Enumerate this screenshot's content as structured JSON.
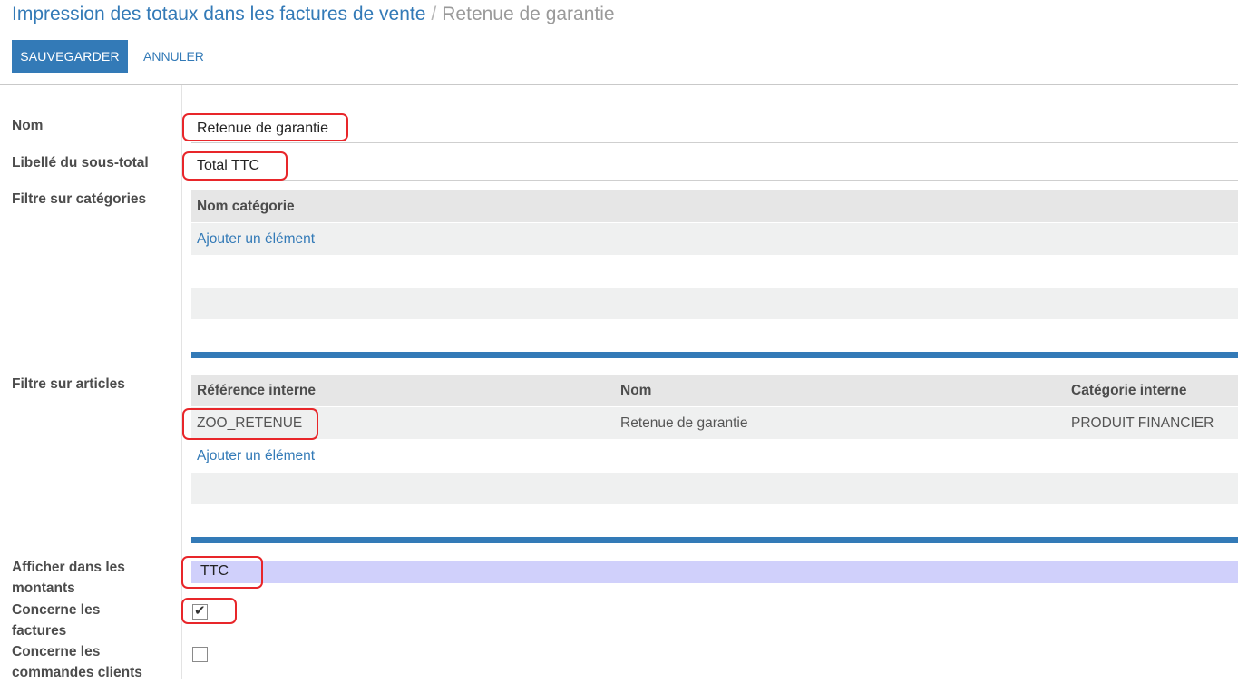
{
  "breadcrumb": {
    "parent": "Impression des totaux dans les factures de vente",
    "separator": "/",
    "current": "Retenue de garantie"
  },
  "toolbar": {
    "save_label": "SAUVEGARDER",
    "cancel_label": "ANNULER"
  },
  "form": {
    "name": {
      "label": "Nom",
      "value": "Retenue de garantie"
    },
    "subtotal_label": {
      "label": "Libellé du sous-total",
      "value": "Total TTC"
    },
    "category_filter": {
      "label": "Filtre sur catégories",
      "columns": [
        "Nom catégorie"
      ],
      "rows": [],
      "add_label": "Ajouter un élément"
    },
    "product_filter": {
      "label": "Filtre sur articles",
      "columns": [
        "Référence interne",
        "Nom",
        "Catégorie interne"
      ],
      "rows": [
        [
          "ZOO_RETENUE",
          "Retenue de garantie",
          "PRODUIT FINANCIER"
        ]
      ],
      "add_label": "Ajouter un élément"
    },
    "amounts": {
      "label": "Afficher dans les montants",
      "value": "TTC"
    },
    "invoices": {
      "label": "Concerne les factures",
      "checked": true
    },
    "sale_orders": {
      "label": "Concerne les commandes clients",
      "checked": false
    }
  },
  "colors": {
    "primary": "#337ab7",
    "highlight": "#e8262a",
    "select_bg": "#d0d0fb"
  }
}
